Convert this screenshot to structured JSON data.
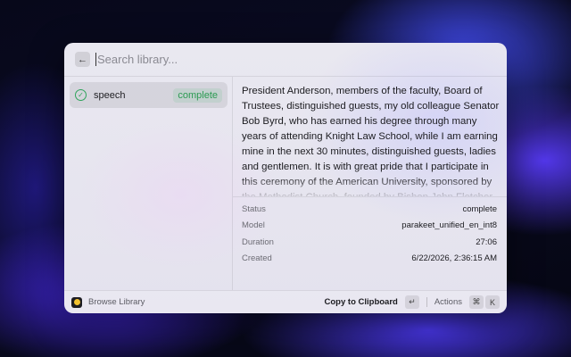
{
  "search": {
    "placeholder": "Search library...",
    "back_icon": "←"
  },
  "sidebar": {
    "items": [
      {
        "name": "speech",
        "status": "complete",
        "icon": "check-circle-icon"
      }
    ]
  },
  "detail": {
    "transcript": "President Anderson, members of the faculty, Board of Trustees, distinguished guests, my old colleague Senator Bob Byrd, who has earned his degree through many years of attending Knight Law School, while I am earning mine in the next 30 minutes, distinguished guests, ladies and gentlemen. It is with great pride that I participate in this ceremony of the American University, sponsored by the Methodist Church, founded by Bishop John Fletcher",
    "meta": [
      {
        "key": "Status",
        "value": "complete"
      },
      {
        "key": "Model",
        "value": "parakeet_unified_en_int8"
      },
      {
        "key": "Duration",
        "value": "27:06"
      },
      {
        "key": "Created",
        "value": "6/22/2026, 2:36:15 AM"
      }
    ]
  },
  "footer": {
    "browse_label": "Browse Library",
    "primary_label": "Copy to Clipboard",
    "primary_key": "↵",
    "actions_label": "Actions",
    "actions_keys": [
      "⌘",
      "K"
    ]
  },
  "colors": {
    "success": "#2fa45b",
    "accent_wallpaper": "#4650ff"
  }
}
